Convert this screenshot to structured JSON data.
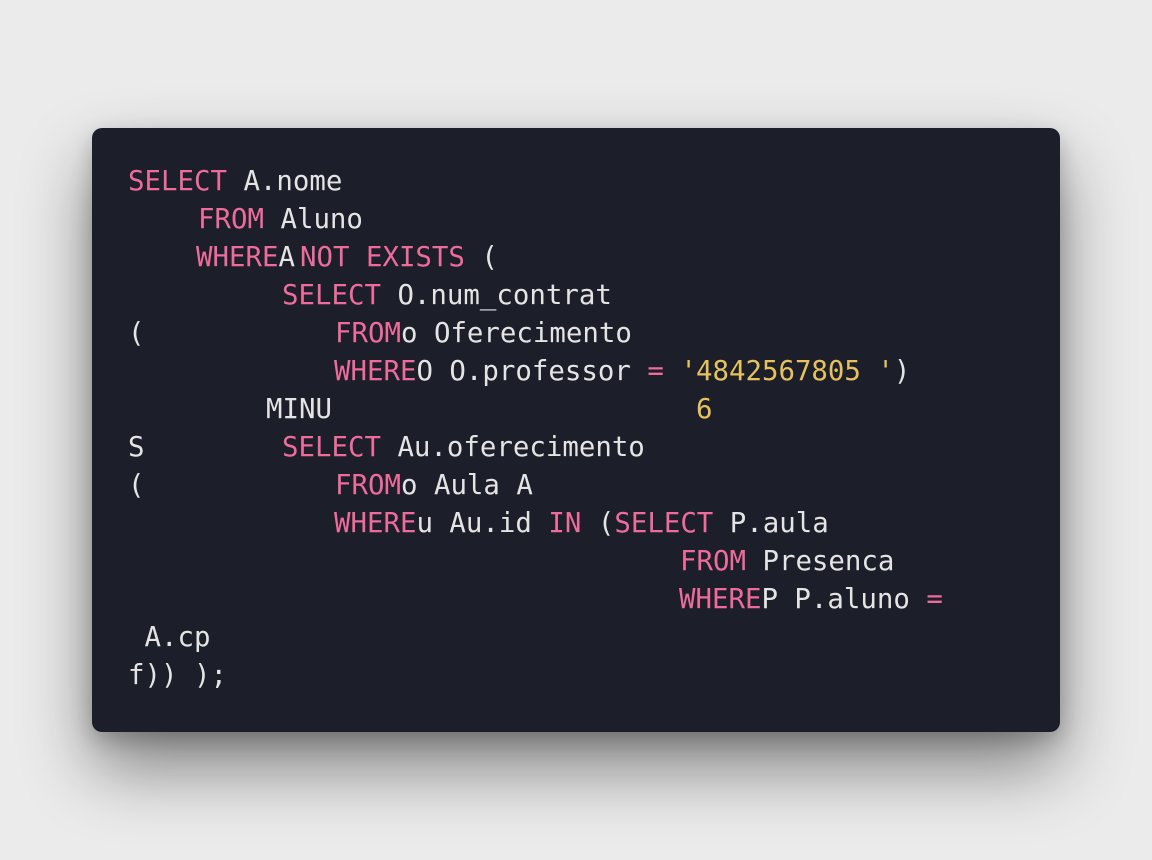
{
  "palette": {
    "page_background": "#ebebeb",
    "editor_background": "#1c1e29",
    "text": "#e4e4e4",
    "keyword": "#ee6c9b",
    "string": "#e5c25e"
  },
  "code": {
    "language": "SQL",
    "lines": [
      [
        {
          "t": "SELECT",
          "k": "kw"
        },
        {
          "t": " A.nome",
          "k": "id"
        }
      ],
      [
        {
          "t": "FROM",
          "k": "kw"
        },
        {
          "t": " Aluno",
          "k": "id"
        }
      ],
      [
        {
          "t": "WHERE",
          "k": "kw"
        },
        {
          "t": "A",
          "k": "id"
        }
      ],
      [
        {
          "t": "NOT EXISTS",
          "k": "kw"
        },
        {
          "t": " (",
          "k": "id"
        }
      ],
      [
        {
          "t": "SELECT",
          "k": "kw"
        },
        {
          "t": " O.num_contrat",
          "k": "id"
        }
      ],
      [
        {
          "t": "(",
          "k": "id"
        }
      ],
      [
        {
          "t": "FROM",
          "k": "kw"
        },
        {
          "t": "o Oferecimento",
          "k": "id"
        }
      ],
      [
        {
          "t": "WHERE",
          "k": "kw"
        },
        {
          "t": "O O.professor ",
          "k": "id"
        },
        {
          "t": "=",
          "k": "kw"
        },
        {
          "t": " '",
          "k": "str"
        }
      ],
      [
        {
          "t": "4842567805 '",
          "k": "str"
        },
        {
          "t": ")",
          "k": "id"
        }
      ],
      [
        {
          "t": "MINU",
          "k": "id"
        }
      ],
      [
        {
          "t": "6",
          "k": "str"
        }
      ],
      [
        {
          "t": "S",
          "k": "id"
        }
      ],
      [
        {
          "t": "SELECT",
          "k": "kw"
        },
        {
          "t": " Au.oferecimento",
          "k": "id"
        }
      ],
      [
        {
          "t": "(",
          "k": "id"
        }
      ],
      [
        {
          "t": "FROM",
          "k": "kw"
        },
        {
          "t": "o Aula A",
          "k": "id"
        }
      ],
      [
        {
          "t": "WHERE",
          "k": "kw"
        },
        {
          "t": "u Au.id ",
          "k": "id"
        },
        {
          "t": "IN",
          "k": "kw"
        },
        {
          "t": " (",
          "k": "id"
        },
        {
          "t": "SELECT",
          "k": "kw"
        },
        {
          "t": " P.aula",
          "k": "id"
        }
      ],
      [
        {
          "t": "FROM",
          "k": "kw"
        },
        {
          "t": " Presenca",
          "k": "id"
        }
      ],
      [
        {
          "t": "WHERE",
          "k": "kw"
        },
        {
          "t": "P P.aluno ",
          "k": "id"
        },
        {
          "t": "=",
          "k": "kw"
        }
      ],
      [
        {
          "t": " A.cp",
          "k": "id"
        }
      ],
      [
        {
          "t": "f)) );",
          "k": "id"
        }
      ]
    ]
  }
}
